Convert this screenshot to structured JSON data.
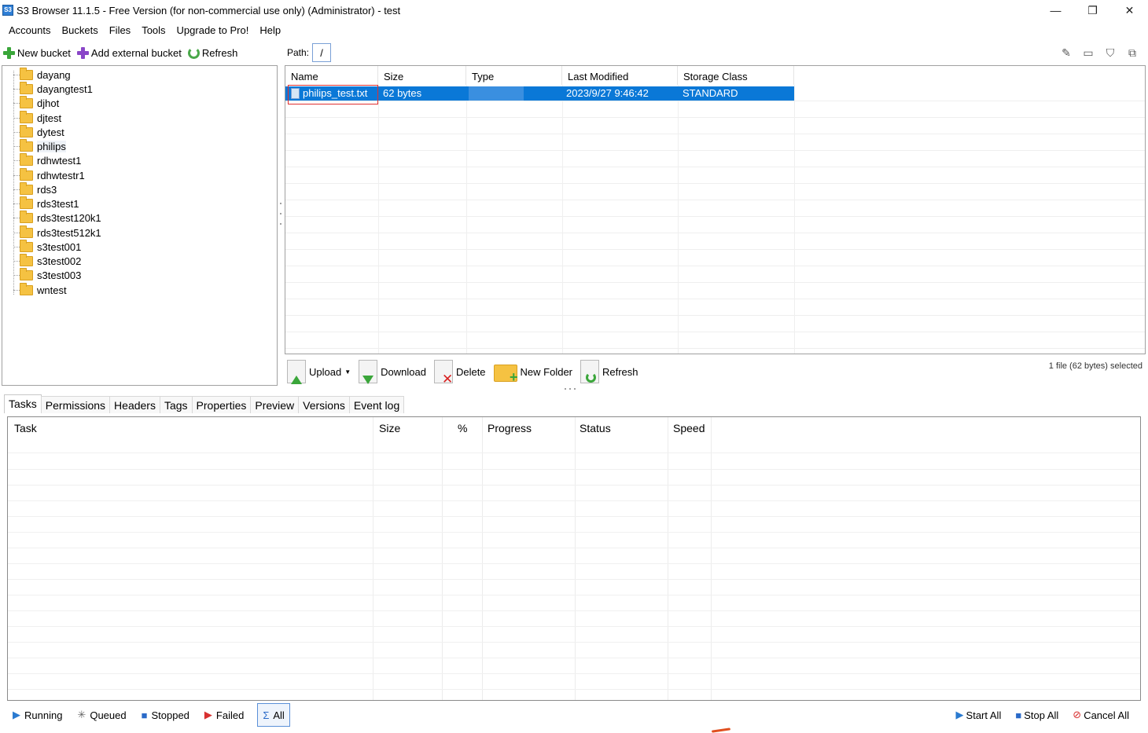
{
  "window": {
    "title": "S3 Browser 11.1.5 - Free Version (for non-commercial use only) (Administrator) - test",
    "icon_text": "S3",
    "minimize_glyph": "—",
    "restore_glyph": "❐",
    "close_glyph": "✕"
  },
  "menu": [
    "Accounts",
    "Buckets",
    "Files",
    "Tools",
    "Upgrade to Pro!",
    "Help"
  ],
  "left_toolbar": {
    "new_bucket": "New bucket",
    "add_external_bucket": "Add external bucket",
    "refresh": "Refresh"
  },
  "path": {
    "label": "Path:",
    "value": "/"
  },
  "buckets": [
    "dayang",
    "dayangtest1",
    "djhot",
    "djtest",
    "dytest",
    "philips",
    "rdhwtest1",
    "rdhwtestr1",
    "rds3",
    "rds3test1",
    "rds3test120k1",
    "rds3test512k1",
    "s3test001",
    "s3test002",
    "s3test003",
    "wntest"
  ],
  "selected_bucket": "philips",
  "file_grid": {
    "columns": [
      "Name",
      "Size",
      "Type",
      "Last Modified",
      "Storage Class"
    ],
    "rows": [
      {
        "name": "philips_test.txt",
        "size": "62 bytes",
        "type": "",
        "last_modified": "2023/9/27 9:46:42",
        "storage_class": "STANDARD"
      }
    ]
  },
  "file_actions": {
    "upload": "Upload",
    "download": "Download",
    "delete": "Delete",
    "new_folder": "New Folder",
    "refresh": "Refresh"
  },
  "selection_info": "1 file (62 bytes) selected",
  "tabs": [
    "Tasks",
    "Permissions",
    "Headers",
    "Tags",
    "Properties",
    "Preview",
    "Versions",
    "Event log"
  ],
  "active_tab": "Tasks",
  "task_grid": {
    "columns": [
      "Task",
      "Size",
      "%",
      "Progress",
      "Status",
      "Speed"
    ]
  },
  "task_filters": {
    "running": "Running",
    "queued": "Queued",
    "stopped": "Stopped",
    "failed": "Failed",
    "all": "All"
  },
  "task_actions": {
    "start_all": "Start All",
    "stop_all": "Stop All",
    "cancel_all": "Cancel All"
  },
  "colors": {
    "selection": "#0a78d7",
    "highlight_box": "#e03030",
    "folder": "#f5c242"
  }
}
